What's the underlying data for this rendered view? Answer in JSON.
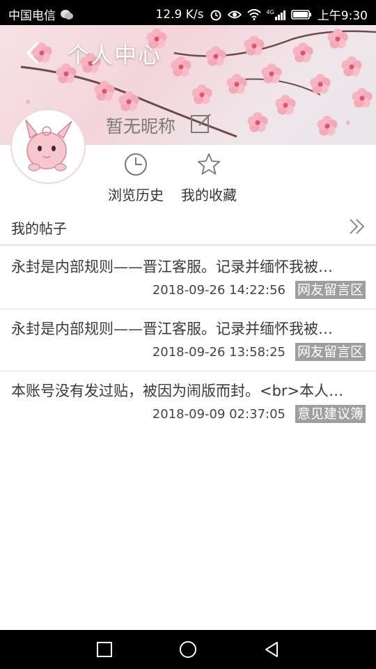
{
  "status_bar": {
    "carrier": "中国电信",
    "speed": "12.9 K/s",
    "network": "4G",
    "time": "上午9:30",
    "icons": [
      "wechat-icon",
      "alarm-icon",
      "eye-icon",
      "wifi-icon",
      "signal-icon",
      "battery-icon"
    ]
  },
  "header": {
    "title": "个人中心",
    "nickname": "暂无昵称"
  },
  "quick_actions": [
    {
      "label": "浏览历史",
      "icon": "clock-icon"
    },
    {
      "label": "我的收藏",
      "icon": "star-icon"
    }
  ],
  "section": {
    "title": "我的帖子"
  },
  "posts": [
    {
      "title": "永封是内部规则——晋江客服。记录并缅怀我被…",
      "date": "2018-09-26 14:22:56",
      "tag": "网友留言区"
    },
    {
      "title": "永封是内部规则——晋江客服。记录并缅怀我被…",
      "date": "2018-09-26 13:58:25",
      "tag": "网友留言区"
    },
    {
      "title": "本账号没有发过贴，被因为闹版而封。<br>本人…",
      "date": "2018-09-09 02:37:05",
      "tag": "意见建议簿"
    }
  ],
  "nav_bar": {
    "icons": [
      "recent-apps-icon",
      "home-icon",
      "back-icon"
    ]
  },
  "colors": {
    "tag_bg": "#9e9e9e",
    "banner_pink": "#f3d5da",
    "blossom": "#f4a9b8"
  }
}
